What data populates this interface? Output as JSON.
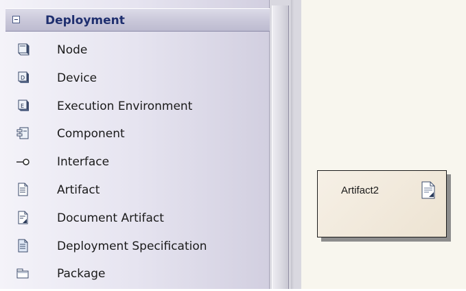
{
  "toolbox": {
    "section": {
      "title": "Deployment",
      "items": [
        {
          "label": "Node",
          "icon": "node-icon"
        },
        {
          "label": "Device",
          "icon": "device-icon"
        },
        {
          "label": "Execution Environment",
          "icon": "execution-environment-icon"
        },
        {
          "label": "Component",
          "icon": "component-icon"
        },
        {
          "label": "Interface",
          "icon": "interface-icon"
        },
        {
          "label": "Artifact",
          "icon": "artifact-icon"
        },
        {
          "label": "Document Artifact",
          "icon": "document-artifact-icon"
        },
        {
          "label": "Deployment Specification",
          "icon": "deployment-specification-icon"
        },
        {
          "label": "Package",
          "icon": "package-icon"
        }
      ]
    }
  },
  "canvas": {
    "artifact": {
      "name": "Artifact2",
      "icon": "artifact-document-icon"
    }
  },
  "colors": {
    "header_text": "#1f2f6f",
    "canvas_background": "#f8f6ee",
    "element_fill": "#f3ece0"
  }
}
